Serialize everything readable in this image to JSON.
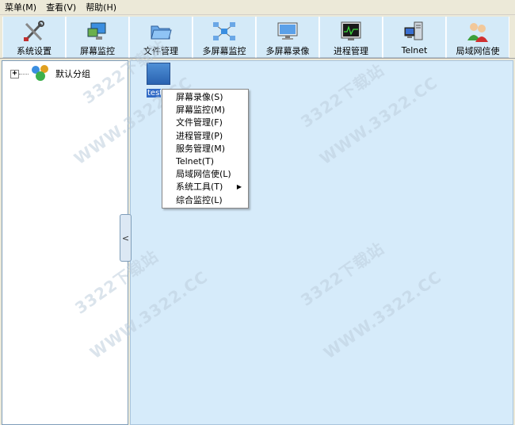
{
  "menubar": {
    "items": [
      "菜单(M)",
      "查看(V)",
      "帮助(H)"
    ]
  },
  "toolbar": {
    "buttons": [
      {
        "label": "系统设置",
        "icon": "tools-icon"
      },
      {
        "label": "屏幕监控",
        "icon": "screen-monitor-icon"
      },
      {
        "label": "文件管理",
        "icon": "folder-icon"
      },
      {
        "label": "多屏幕监控",
        "icon": "network-icon"
      },
      {
        "label": "多屏幕录像",
        "icon": "display-icon"
      },
      {
        "label": "进程管理",
        "icon": "process-icon"
      },
      {
        "label": "Telnet",
        "icon": "computer-tower-icon"
      },
      {
        "label": "局域网信使",
        "icon": "users-icon"
      }
    ]
  },
  "tree": {
    "root": {
      "label": "默认分组",
      "expander": "+"
    }
  },
  "monitor": {
    "client": {
      "name": "test"
    }
  },
  "context_menu": {
    "items": [
      "屏幕录像(S)",
      "屏幕监控(M)",
      "文件管理(F)",
      "进程管理(P)",
      "服务管理(M)",
      "Telnet(T)",
      "局域网信使(L)",
      "系统工具(T)",
      "综合监控(L)"
    ],
    "submenu_arrow": "▶"
  },
  "splitter": {
    "glyph": "<"
  },
  "watermarks": [
    "3322下载站",
    "WWW.3322.CC"
  ],
  "colors": {
    "toolbar_button_bg": "#d4eaf8",
    "monitor_bg": "#d6ebfa",
    "selection": "#316ac5",
    "window_bg": "#ece9d8"
  }
}
